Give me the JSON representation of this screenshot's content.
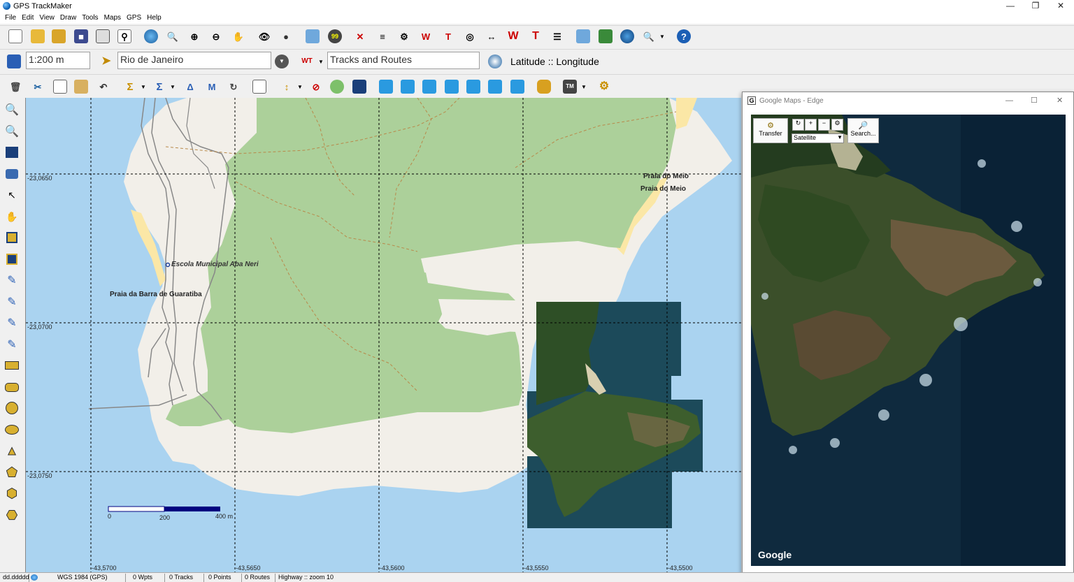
{
  "window": {
    "title": "GPS TrackMaker"
  },
  "menu": [
    "File",
    "Edit",
    "View",
    "Draw",
    "Tools",
    "Maps",
    "GPS",
    "Help"
  ],
  "toolbar2": {
    "scale_value": "1:200 m",
    "location_value": "Rio de Janeiro",
    "layer_value": "Tracks and Routes",
    "coord_format": "Latitude :: Longitude"
  },
  "map": {
    "lat_labels": [
      "-23,0650",
      "-23,0700",
      "-23,0750"
    ],
    "lon_labels": [
      "-43,5700",
      "-43,5650",
      "-43,5600",
      "-43,5550",
      "-43,5500"
    ],
    "places": {
      "praia_meio_1": "Praia do Meio",
      "praia_meio_2": "Praia do Meio",
      "escola": "Escola Municipal Aba Neri",
      "barra": "Praia da Barra de Guaratiba"
    },
    "scalebar": {
      "tick0": "0",
      "tick1": "200",
      "tick2": "400 m"
    }
  },
  "google_window": {
    "title": "Google Maps - Edge",
    "transfer_label": "Transfer",
    "maptype_value": "Satellite",
    "search_label": "Search...",
    "watermark": "Google"
  },
  "status": {
    "format": "dd.ddddd",
    "datum": "WGS 1984 (GPS)",
    "wpts": "0 Wpts",
    "tracks": "0 Tracks",
    "points": "0 Points",
    "routes": "0 Routes",
    "zoom": "Highway :: zoom 10"
  },
  "colors": {
    "water": "#aad3f0",
    "forest": "#acd09a",
    "land": "#f2efe9",
    "beach": "#fbe7a6",
    "grid": "#000000"
  }
}
